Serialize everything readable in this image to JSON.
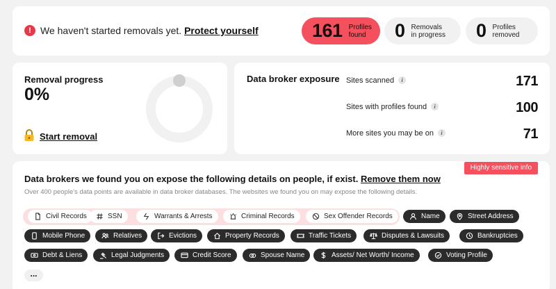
{
  "banner": {
    "alert_text": "We haven't started removals yet.",
    "alert_link": "Protect yourself",
    "stats": [
      {
        "value": "161",
        "label_line1": "Profiles",
        "label_line2": "found"
      },
      {
        "value": "0",
        "label_line1": "Removals",
        "label_line2": "in progress"
      },
      {
        "value": "0",
        "label_line1": "Profiles",
        "label_line2": "removed"
      }
    ]
  },
  "removal_progress": {
    "title": "Removal progress",
    "percent": "0%",
    "fraction": 0,
    "start_label": "Start removal"
  },
  "exposure": {
    "title": "Data broker exposure",
    "rows": [
      {
        "label": "Sites scanned",
        "value": "171"
      },
      {
        "label": "Sites with profiles found",
        "value": "100"
      },
      {
        "label": "More sites you may be on",
        "value": "71"
      }
    ]
  },
  "details": {
    "badge": "Highly sensitive info",
    "title": "Data brokers we found you on expose the following details on people, if exist.",
    "title_link": "Remove them now",
    "subtitle": "Over 400 people's data points are available in data broker databases. The websites we found you on may expose the following details.",
    "sensitive_chips": [
      "Civil Records",
      "SSN",
      "Warrants & Arrests",
      "Criminal Records",
      "Sex Offender Records"
    ],
    "chips_row1": [
      "Name",
      "Street Address"
    ],
    "chips_row2": [
      "Mobile Phone",
      "Relatives",
      "Evictions",
      "Property Records",
      "Traffic Tickets",
      "Disputes & Lawsuits",
      "Bankruptcies"
    ],
    "chips_row3": [
      "Debt & Liens",
      "Legal Judgments",
      "Credit Score",
      "Spouse Name",
      "Assets/ Net Worth/ Income",
      "Voting Profile"
    ],
    "more_label": "..."
  },
  "colors": {
    "accent": "#f4505e",
    "dark_chip": "#2b2b2b",
    "sensitive_bg": "#fbdfe1"
  }
}
